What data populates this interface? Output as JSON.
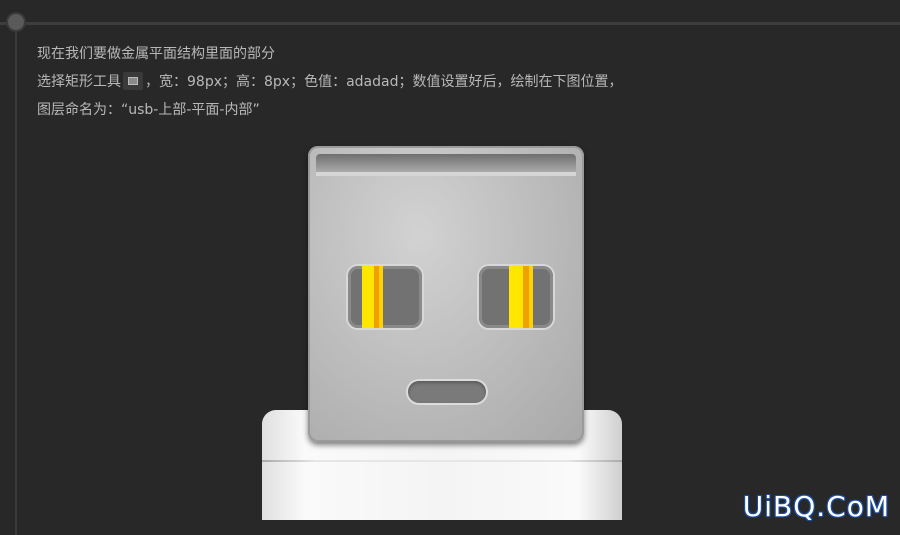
{
  "tutorial": {
    "line1": "现在我们要做金属平面结构里面的部分",
    "line2_before": "选择矩形工具",
    "line2_after": "，宽：98px；高：8px；色值：adadad；数值设置好后，绘制在下图位置，",
    "line3": "图层命名为：“usb-上部-平面-内部”",
    "tool_icon": "rectangle-tool-icon"
  },
  "watermark": {
    "text": "UiBQ.CoM"
  },
  "colors": {
    "background": "#282828",
    "text": "#b8b8b8",
    "stripe_yellow": "#ffe600",
    "stripe_orange": "#f0a000",
    "hole_gray": "#727272"
  }
}
